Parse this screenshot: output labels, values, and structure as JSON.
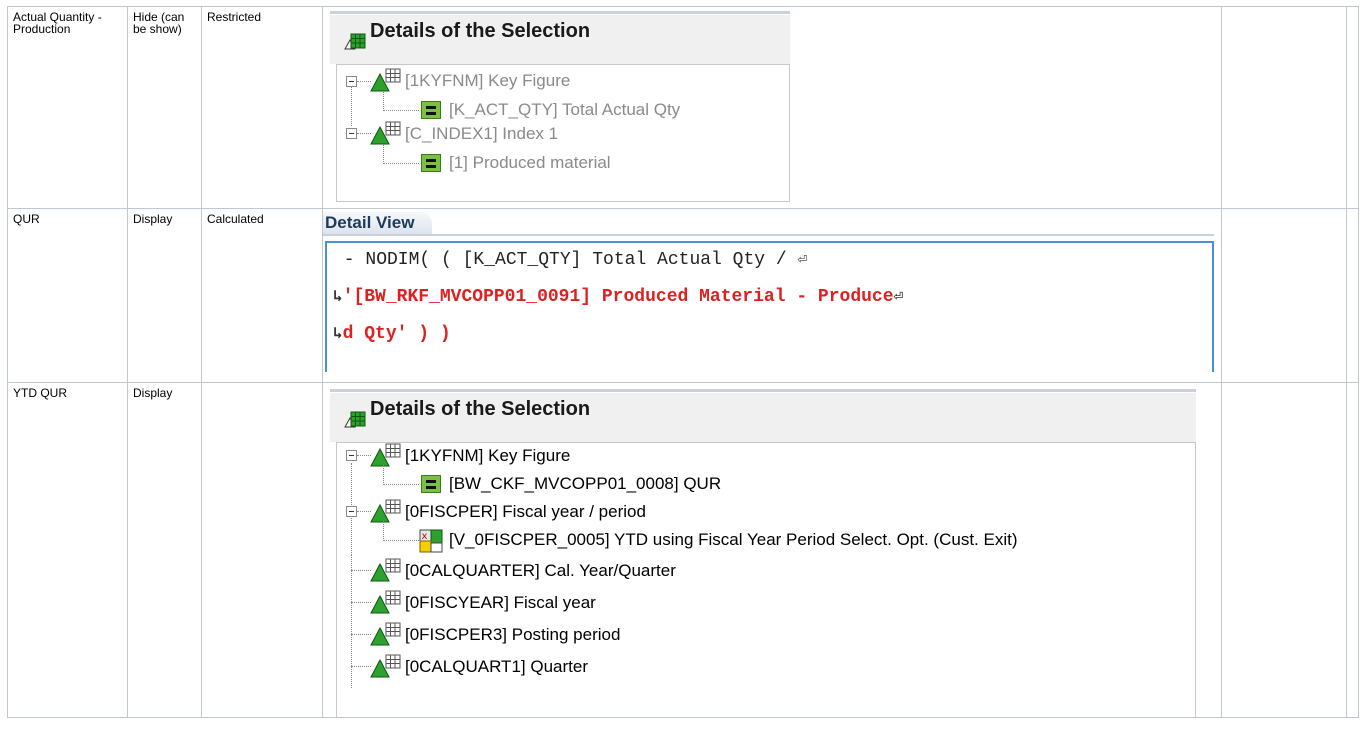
{
  "rows": [
    {
      "name": "Actual Quantity - Production",
      "visibility": "Hide (can be show)",
      "type": "Restricted",
      "panel": {
        "title": "Details of the Selection",
        "tree": [
          {
            "label": "[1KYFNM] Key Figure",
            "icon": "characteristic-icon"
          },
          {
            "label": "[K_ACT_QTY] Total Actual Qty",
            "icon": "key-figure-icon"
          },
          {
            "label": "[C_INDEX1] Index 1",
            "icon": "characteristic-icon"
          },
          {
            "label": "[1] Produced material",
            "icon": "key-figure-icon"
          }
        ]
      }
    },
    {
      "name": "QUR",
      "visibility": "Display",
      "type": "Calculated",
      "detail_view": {
        "tab": "Detail View",
        "line1": " - NODIM( ( [K_ACT_QTY] Total Actual Qty / ",
        "line2": "'[BW_RKF_MVCOPP01_0091] Produced Material - Produce",
        "line3": "d Qty' ) )",
        "wrap_symbol": "⏎",
        "continue_symbol": "↳"
      }
    },
    {
      "name": "YTD QUR",
      "visibility": "Display",
      "type": "",
      "panel": {
        "title": "Details of the Selection",
        "tree": [
          {
            "label": "[1KYFNM] Key Figure",
            "icon": "characteristic-icon"
          },
          {
            "label": "[BW_CKF_MVCOPP01_0008] QUR",
            "icon": "key-figure-icon"
          },
          {
            "label": "[0FISCPER] Fiscal year / period",
            "icon": "characteristic-icon"
          },
          {
            "label": "[V_0FISCPER_0005] YTD using Fiscal Year Period Select. Opt. (Cust. Exit)",
            "icon": "variable-icon"
          },
          {
            "label": "[0CALQUARTER] Cal. Year/Quarter",
            "icon": "characteristic-icon"
          },
          {
            "label": "[0FISCYEAR] Fiscal year",
            "icon": "characteristic-icon"
          },
          {
            "label": "[0FISCPER3] Posting period",
            "icon": "characteristic-icon"
          },
          {
            "label": "[0CALQUART1] Quarter",
            "icon": "characteristic-icon"
          }
        ]
      }
    }
  ]
}
